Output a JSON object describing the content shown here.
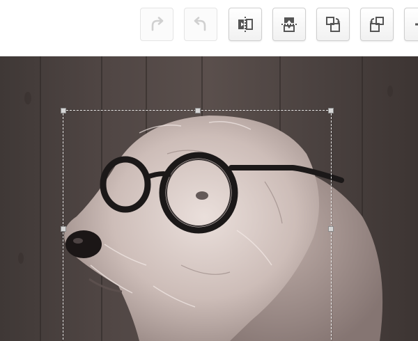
{
  "toolbar": {
    "buttons": [
      {
        "icon": "redo-icon",
        "enabled": false
      },
      {
        "icon": "undo-icon",
        "enabled": false
      },
      {
        "icon": "flip-horizontal-icon",
        "enabled": true
      },
      {
        "icon": "flip-vertical-icon",
        "enabled": true
      },
      {
        "icon": "rotate-left-icon",
        "enabled": true
      },
      {
        "icon": "rotate-right-icon",
        "enabled": true
      },
      {
        "icon": "add-icon",
        "enabled": true
      }
    ]
  },
  "editor": {
    "image": "dog-with-glasses",
    "crop_selection": {
      "visible": true,
      "handles": 6
    },
    "colors": {
      "background": "#47403d",
      "dashed_border": "#ffffff",
      "icon": "#555555",
      "icon_disabled": "#d0d0d0"
    }
  }
}
